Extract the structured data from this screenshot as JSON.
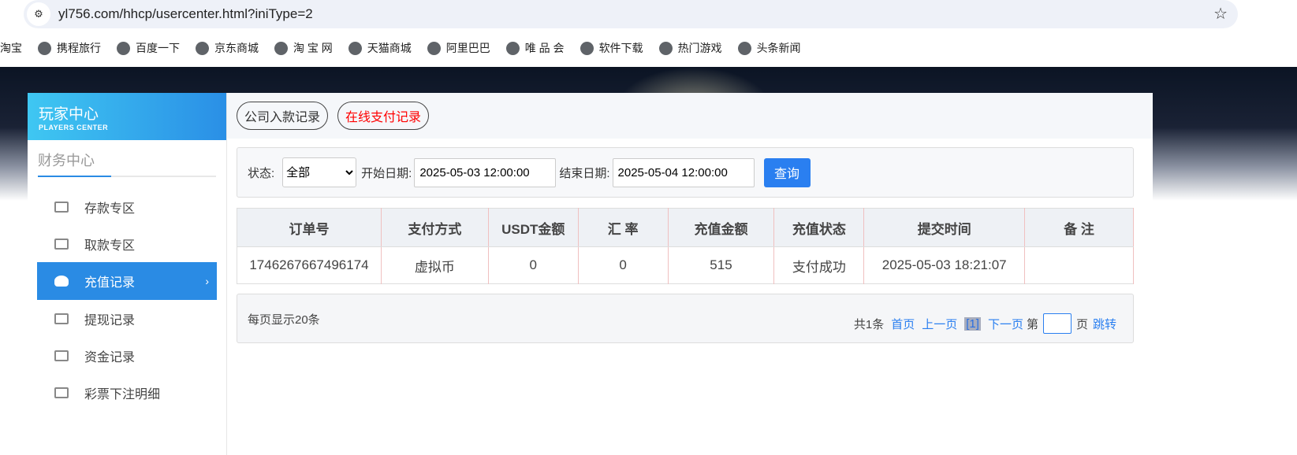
{
  "browser": {
    "url": "yl756.com/hhcp/usercenter.html?iniType=2",
    "bookmarks": [
      "淘宝",
      "携程旅行",
      "百度一下",
      "京东商城",
      "淘 宝 网",
      "天猫商城",
      "阿里巴巴",
      "唯 品 会",
      "软件下载",
      "热门游戏",
      "头条新闻"
    ]
  },
  "sidebar": {
    "logo_title": "玩家中心",
    "logo_sub": "PLAYERS CENTER",
    "section": "财务中心",
    "items": [
      {
        "label": "存款专区"
      },
      {
        "label": "取款专区"
      },
      {
        "label": "充值记录",
        "active": true
      },
      {
        "label": "提现记录"
      },
      {
        "label": "资金记录"
      },
      {
        "label": "彩票下注明细"
      }
    ]
  },
  "tabs": [
    {
      "label": "公司入款记录"
    },
    {
      "label": "在线支付记录",
      "active": true
    }
  ],
  "filter": {
    "status_label": "状态:",
    "status_value": "全部",
    "start_label": "开始日期:",
    "start_value": "2025-05-03 12:00:00",
    "end_label": "结束日期:",
    "end_value": "2025-05-04 12:00:00",
    "query": "查询"
  },
  "table": {
    "headers": [
      "订单号",
      "支付方式",
      "USDT金额",
      "汇 率",
      "充值金额",
      "充值状态",
      "提交时间",
      "备 注"
    ],
    "rows": [
      [
        "174626766749617​4",
        "虚拟币",
        "0",
        "0",
        "515",
        "支付成功",
        "2025-05-03 18:21:07",
        ""
      ]
    ]
  },
  "pagination": {
    "per_page": "每页显示20条",
    "total": "共1条",
    "first": "首页",
    "prev": "上一页",
    "current": "[1]",
    "next": "下一页",
    "page_prefix": "第",
    "page_suffix": "页",
    "jump": "跳转"
  },
  "colors": {
    "accent": "#2a8be4",
    "active_tab": "#ff0000"
  }
}
